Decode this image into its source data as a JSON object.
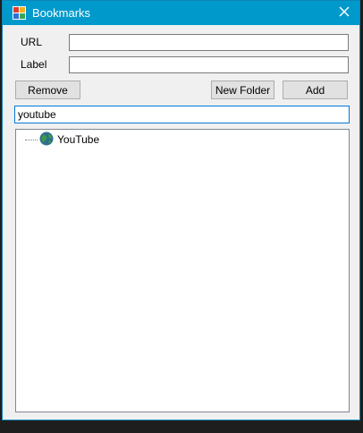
{
  "window": {
    "title": "Bookmarks",
    "titlebar_color": "#0099cc",
    "app_icon": "bookmarks-app-icon",
    "close_icon": "close-icon"
  },
  "form": {
    "url_label": "URL",
    "url_value": "",
    "label_label": "Label",
    "label_value": ""
  },
  "buttons": {
    "remove": "Remove",
    "new_folder": "New Folder",
    "add": "Add"
  },
  "search": {
    "value": "youtube"
  },
  "tree": {
    "items": [
      {
        "label": "YouTube",
        "icon": "globe-icon"
      }
    ]
  }
}
